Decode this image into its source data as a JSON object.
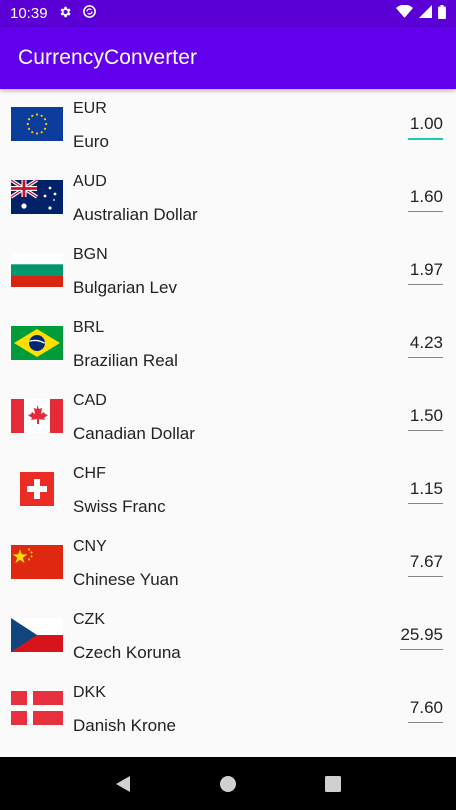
{
  "status_bar": {
    "time": "10:39"
  },
  "app_bar": {
    "title": "CurrencyConverter"
  },
  "currencies": [
    {
      "code": "EUR",
      "name": "Euro",
      "value": "1.00"
    },
    {
      "code": "AUD",
      "name": "Australian Dollar",
      "value": "1.60"
    },
    {
      "code": "BGN",
      "name": "Bulgarian Lev",
      "value": "1.97"
    },
    {
      "code": "BRL",
      "name": "Brazilian Real",
      "value": "4.23"
    },
    {
      "code": "CAD",
      "name": "Canadian Dollar",
      "value": "1.50"
    },
    {
      "code": "CHF",
      "name": "Swiss Franc",
      "value": "1.15"
    },
    {
      "code": "CNY",
      "name": "Chinese Yuan",
      "value": "7.67"
    },
    {
      "code": "CZK",
      "name": "Czech Koruna",
      "value": "25.95"
    },
    {
      "code": "DKK",
      "name": "Danish Krone",
      "value": "7.60"
    }
  ],
  "colors": {
    "primary": "#6200ee",
    "status": "#5a00d6",
    "accent": "#1ec6b4"
  }
}
